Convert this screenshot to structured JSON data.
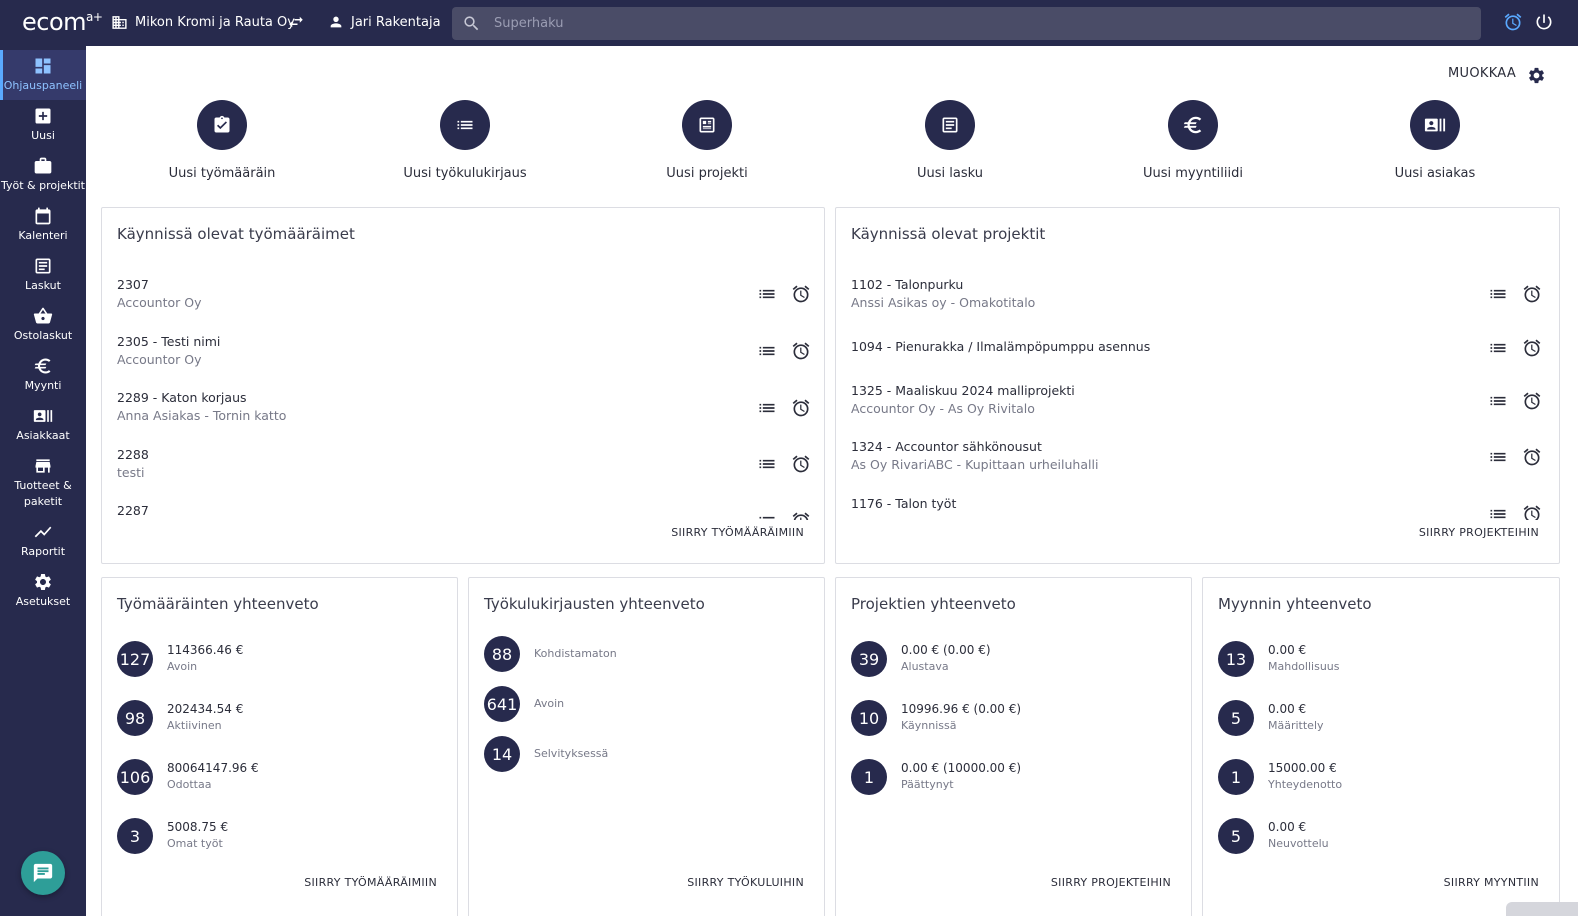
{
  "topbar": {
    "logo": "ecom",
    "logo_sup": "a+",
    "company": "Mikon Kromi ja Rauta Oy",
    "user": "Jari Rakentaja",
    "search_placeholder": "Superhaku"
  },
  "sidebar": {
    "items": [
      {
        "label": "Ohjauspaneeli",
        "icon": "dashboard-icon",
        "active": true
      },
      {
        "label": "Uusi",
        "icon": "plus-box-icon"
      },
      {
        "label": "Työt & projektit",
        "icon": "briefcase-icon"
      },
      {
        "label": "Kalenteri",
        "icon": "calendar-icon"
      },
      {
        "label": "Laskut",
        "icon": "invoice-icon"
      },
      {
        "label": "Ostolaskut",
        "icon": "basket-icon"
      },
      {
        "label": "Myynti",
        "icon": "euro-icon"
      },
      {
        "label": "Asiakkaat",
        "icon": "contact-card-icon"
      },
      {
        "label": "Tuotteet &",
        "label2": "paketit",
        "icon": "store-icon"
      },
      {
        "label": "Raportit",
        "icon": "chart-line-icon"
      },
      {
        "label": "Asetukset",
        "icon": "gear-icon"
      }
    ]
  },
  "main": {
    "edit_label": "MUOKKAA",
    "quick_actions": [
      {
        "label": "Uusi työmääräin",
        "icon": "clipboard-check-icon"
      },
      {
        "label": "Uusi työkulukirjaus",
        "icon": "list-icon"
      },
      {
        "label": "Uusi projekti",
        "icon": "project-icon"
      },
      {
        "label": "Uusi lasku",
        "icon": "invoice-icon"
      },
      {
        "label": "Uusi myyntiliidi",
        "icon": "euro-icon"
      },
      {
        "label": "Uusi asiakas",
        "icon": "contact-card-icon"
      }
    ],
    "workorders": {
      "title": "Käynnissä olevat työmääräimet",
      "link": "SIIRRY TYÖMÄÄRÄIMIIN",
      "rows": [
        {
          "title": "2307",
          "sub": "Accountor Oy"
        },
        {
          "title": "2305 - Testi nimi",
          "sub": "Accountor Oy"
        },
        {
          "title": "2289 - Katon korjaus",
          "sub": "Anna Asiakas - Tornin katto"
        },
        {
          "title": "2288",
          "sub": "testi"
        },
        {
          "title": "2287",
          "sub": ""
        }
      ]
    },
    "projects": {
      "title": "Käynnissä olevat projektit",
      "link": "SIIRRY PROJEKTEIHIN",
      "rows": [
        {
          "title": "1102 - Talonpurku",
          "sub": "Anssi Asikas oy - Omakotitalo"
        },
        {
          "title": "1094 - Pienurakka / Ilmalämpöpumppu asennus",
          "sub": ""
        },
        {
          "title": "1325 - Maaliskuu 2024 malliprojekti",
          "sub": "Accountor Oy - As Oy Rivitalo"
        },
        {
          "title": "1324 - Accountor sähkönousut",
          "sub": "As Oy RivariABC - Kupittaan urheiluhalli"
        },
        {
          "title": "1176 - Talon työt",
          "sub": ""
        }
      ]
    },
    "wo_summary": {
      "title": "Työmääräinten yhteenveto",
      "link": "SIIRRY TYÖMÄÄRÄIMIIN",
      "stats": [
        {
          "count": "127",
          "value": "114366.46 €",
          "label": "Avoin"
        },
        {
          "count": "98",
          "value": "202434.54 €",
          "label": "Aktiivinen"
        },
        {
          "count": "106",
          "value": "80064147.96 €",
          "label": "Odottaa"
        },
        {
          "count": "3",
          "value": "5008.75 €",
          "label": "Omat työt"
        }
      ]
    },
    "cost_summary": {
      "title": "Työkulukirjausten yhteenveto",
      "link": "SIIRRY TYÖKULUIHIN",
      "stats": [
        {
          "count": "88",
          "label": "Kohdistamaton"
        },
        {
          "count": "641",
          "label": "Avoin"
        },
        {
          "count": "14",
          "label": "Selvityksessä"
        }
      ]
    },
    "project_summary": {
      "title": "Projektien yhteenveto",
      "link": "SIIRRY PROJEKTEIHIN",
      "stats": [
        {
          "count": "39",
          "value": "0.00 € (0.00 €)",
          "label": "Alustava"
        },
        {
          "count": "10",
          "value": "10996.96 € (0.00 €)",
          "label": "Käynnissä"
        },
        {
          "count": "1",
          "value": "0.00 € (10000.00 €)",
          "label": "Päättynyt"
        }
      ]
    },
    "sales_summary": {
      "title": "Myynnin yhteenveto",
      "link": "SIIRRY MYYNTIIN",
      "stats": [
        {
          "count": "13",
          "value": "0.00 €",
          "label": "Mahdollisuus"
        },
        {
          "count": "5",
          "value": "0.00 €",
          "label": "Määrittely"
        },
        {
          "count": "1",
          "value": "15000.00 €",
          "label": "Yhteydenotto"
        },
        {
          "count": "5",
          "value": "0.00 €",
          "label": "Neuvottelu"
        }
      ]
    }
  },
  "colors": {
    "nav_bg": "#272a4d",
    "accent_active": "#8ec2ff",
    "chat_button": "#2e9e98"
  }
}
